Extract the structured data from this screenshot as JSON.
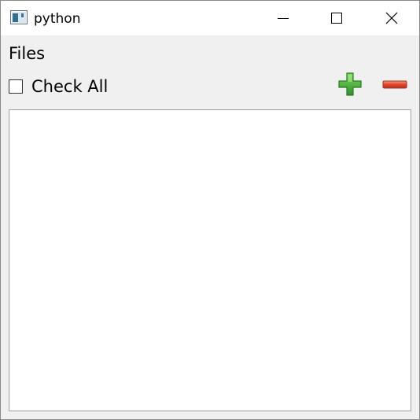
{
  "window": {
    "title": "python",
    "app_icon": "python-window-icon",
    "controls": {
      "minimize_icon": "minimize-icon",
      "maximize_icon": "maximize-icon",
      "close_icon": "close-icon"
    }
  },
  "files": {
    "heading": "Files",
    "check_all_label": "Check All",
    "check_all_checked": false,
    "add_icon": "plus-icon",
    "remove_icon": "minus-icon",
    "items": []
  },
  "colors": {
    "add_green": "#3fa53a",
    "remove_red": "#e0452b",
    "window_bg": "#f0f0f0",
    "list_bg": "#ffffff"
  }
}
